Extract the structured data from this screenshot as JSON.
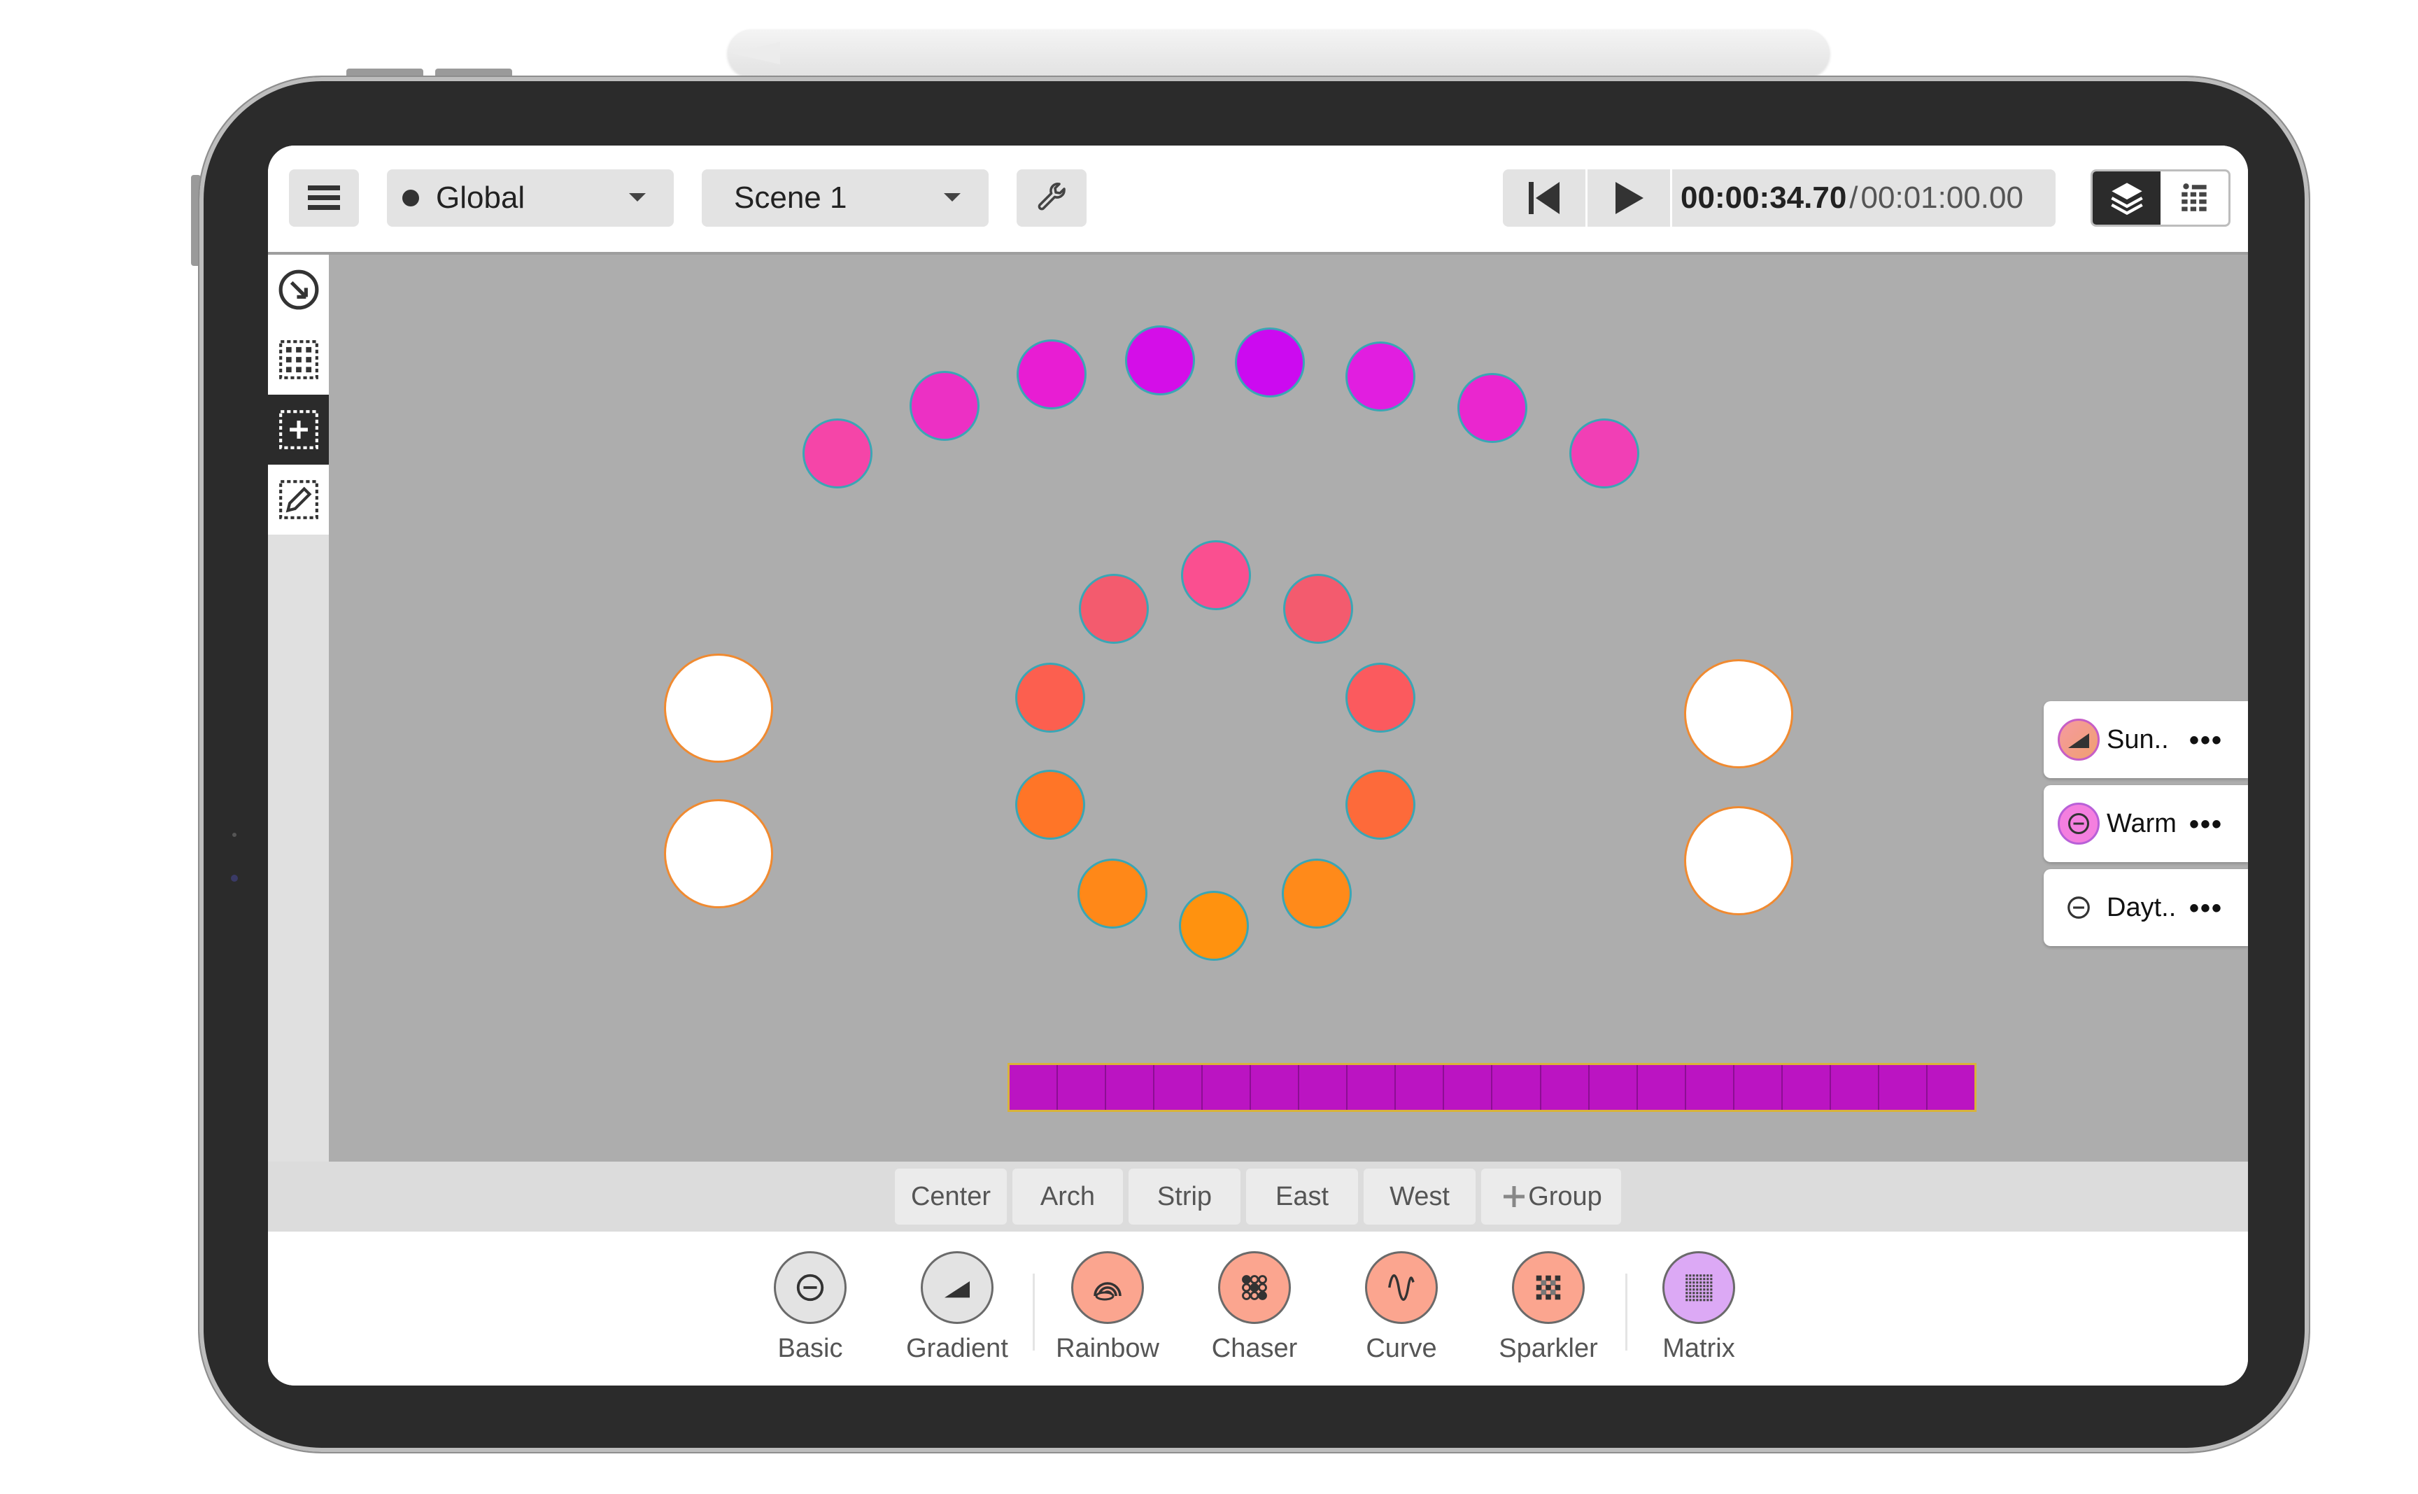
{
  "toolbar": {
    "menu_icon": "hamburger-menu-icon",
    "global_select": {
      "value": "Global"
    },
    "scene_select": {
      "value": "Scene 1"
    },
    "tools_icon": "wrench-icon",
    "transport": {
      "skip_back_icon": "skip-to-start-icon",
      "play_icon": "play-icon",
      "current_time": "00:00:34.70",
      "separator": "/",
      "total_time": "00:01:00.00"
    },
    "view_toggle": {
      "options": [
        {
          "icon": "layers-icon",
          "active": true
        },
        {
          "icon": "fixtures-grid-icon",
          "active": false
        }
      ]
    }
  },
  "left_tools": [
    {
      "name": "select-tool",
      "icon": "compass-select-icon",
      "active": false
    },
    {
      "name": "grid-tool",
      "icon": "grid-select-icon",
      "active": false
    },
    {
      "name": "add-tool",
      "icon": "add-box-icon",
      "active": true
    },
    {
      "name": "edit-tool",
      "icon": "edit-box-icon",
      "active": false
    }
  ],
  "canvas": {
    "background": "#adadad",
    "arch_fixtures": [
      "#f545a8",
      "#ec30c4",
      "#e81dd3",
      "#d40ee8",
      "#cc0af0",
      "#e11ee0",
      "#ea26cf",
      "#f13fb5"
    ],
    "ring_fixtures": [
      "#fa4f90",
      "#f7587a",
      "#f35b6e",
      "#fb5a5e",
      "#fc5f4f",
      "#fd6a3a",
      "#ff7527",
      "#ff7a21",
      "#ff8818",
      "#ff8a1a",
      "#ff9012",
      "#ff920f"
    ],
    "side_fixtures": [
      "#ffffff",
      "#ffffff",
      "#ffffff",
      "#ffffff"
    ],
    "strip_color": "#bb14c2",
    "strip_cells": 20
  },
  "layers": [
    {
      "label": "Sun..",
      "icon": "gradient-effect-icon",
      "more_label": "•••"
    },
    {
      "label": "Warm",
      "icon": "basic-effect-icon",
      "more_label": "•••"
    },
    {
      "label": "Dayt..",
      "icon": "basic-effect-icon",
      "more_label": "•••"
    }
  ],
  "groups": [
    {
      "label": "Center"
    },
    {
      "label": "Arch"
    },
    {
      "label": "Strip"
    },
    {
      "label": "East"
    },
    {
      "label": "West"
    },
    {
      "label": "Group",
      "icon": "plus-icon"
    }
  ],
  "effects": [
    {
      "label": "Basic",
      "icon": "basic-effect-icon",
      "color": "#e3e3e3"
    },
    {
      "label": "Gradient",
      "icon": "gradient-effect-icon",
      "color": "#e3e3e3"
    },
    {
      "label": "Rainbow",
      "icon": "rainbow-effect-icon",
      "color": "#fba58f"
    },
    {
      "label": "Chaser",
      "icon": "chaser-effect-icon",
      "color": "#fba58f"
    },
    {
      "label": "Curve",
      "icon": "curve-effect-icon",
      "color": "#fba58f"
    },
    {
      "label": "Sparkler",
      "icon": "sparkler-effect-icon",
      "color": "#fba58f"
    },
    {
      "label": "Matrix",
      "icon": "matrix-effect-icon",
      "color": "#dca9f5"
    }
  ]
}
